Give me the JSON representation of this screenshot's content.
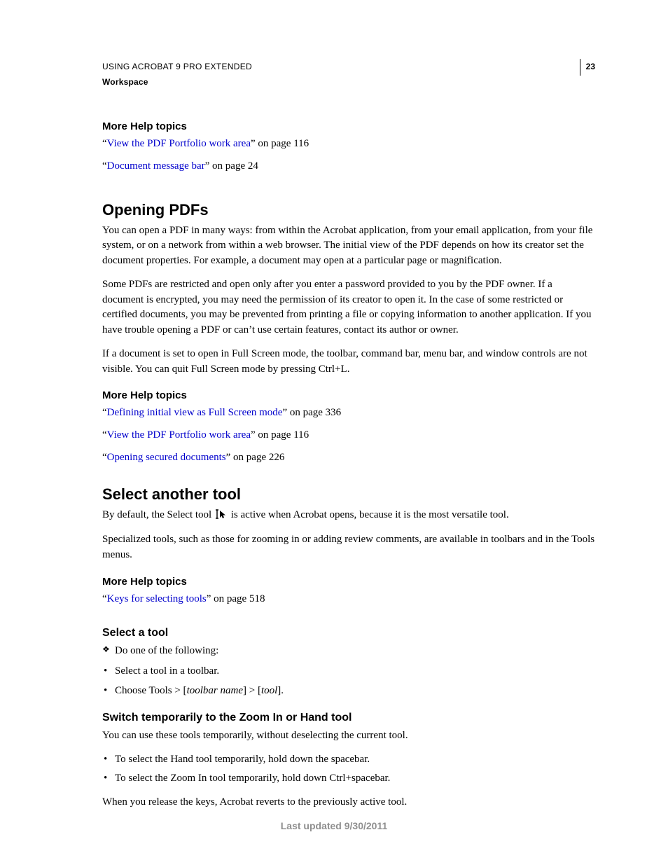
{
  "header": {
    "title": "USING ACROBAT 9 PRO EXTENDED",
    "subtitle": "Workspace",
    "page_number": "23"
  },
  "help1": {
    "heading": "More Help topics",
    "items": [
      {
        "q1": "“",
        "link": "View the PDF Portfolio work area",
        "suffix": "” on page 116"
      },
      {
        "q1": "“",
        "link": "Document message bar",
        "suffix": "” on page 24"
      }
    ]
  },
  "opening": {
    "heading": "Opening PDFs",
    "p1": "You can open a PDF in many ways: from within the Acrobat application, from your email application, from your file system, or on a network from within a web browser. The initial view of the PDF depends on how its creator set the document properties. For example, a document may open at a particular page or magnification.",
    "p2": "Some PDFs are restricted and open only after you enter a password provided to you by the PDF owner. If a document is encrypted, you may need the permission of its creator to open it. In the case of some restricted or certified documents, you may be prevented from printing a file or copying information to another application. If you have trouble opening a PDF or can’t use certain features, contact its author or owner.",
    "p3": "If a document is set to open in Full Screen mode, the toolbar, command bar, menu bar, and window controls are not visible. You can quit Full Screen mode by pressing Ctrl+L."
  },
  "help2": {
    "heading": "More Help topics",
    "items": [
      {
        "q1": "“",
        "link": "Defining initial view as Full Screen mode",
        "suffix": "” on page 336"
      },
      {
        "q1": "“",
        "link": "View the PDF Portfolio work area",
        "suffix": "” on page 116"
      },
      {
        "q1": "“",
        "link": "Opening secured documents",
        "suffix": "” on page 226"
      }
    ]
  },
  "select_another": {
    "heading": "Select another tool",
    "p1_a": "By default, the Select tool ",
    "p1_b": " is active when Acrobat opens, because it is the most versatile tool.",
    "p2": "Specialized tools, such as those for zooming in or adding review comments, are available in toolbars and in the Tools menus."
  },
  "help3": {
    "heading": "More Help topics",
    "items": [
      {
        "q1": "“",
        "link": "Keys for selecting tools",
        "suffix": "” on page 518"
      }
    ]
  },
  "select_a_tool": {
    "heading": "Select a tool",
    "diamond": "Do one of the following:",
    "b1": "Select a tool in a toolbar.",
    "b2_a": "Choose Tools > [",
    "b2_i1": "toolbar name",
    "b2_b": "] > [",
    "b2_i2": "tool",
    "b2_c": "]."
  },
  "switch": {
    "heading": "Switch temporarily to the Zoom In or Hand tool",
    "p1": "You can use these tools temporarily, without deselecting the current tool.",
    "b1": "To select the Hand tool temporarily, hold down the spacebar.",
    "b2": "To select the Zoom In tool temporarily, hold down Ctrl+spacebar.",
    "p2": "When you release the keys, Acrobat reverts to the previously active tool."
  },
  "footer": "Last updated 9/30/2011"
}
